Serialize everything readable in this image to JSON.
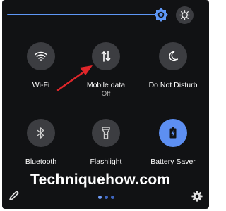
{
  "quick_settings": {
    "brightness": {
      "level": 0.96
    },
    "tiles": [
      {
        "id": "wifi",
        "label": "Wi-Fi",
        "icon": "wifi-icon",
        "active": false
      },
      {
        "id": "mobile-data",
        "label": "Mobile data",
        "status": "Off",
        "icon": "mobile-data-icon",
        "active": false
      },
      {
        "id": "do-not-disturb",
        "label": "Do Not Disturb",
        "icon": "moon-icon",
        "active": false
      },
      {
        "id": "bluetooth",
        "label": "Bluetooth",
        "icon": "bluetooth-icon",
        "active": false
      },
      {
        "id": "flashlight",
        "label": "Flashlight",
        "icon": "flashlight-icon",
        "active": false
      },
      {
        "id": "battery-saver",
        "label": "Battery Saver",
        "icon": "battery-icon",
        "active": true
      }
    ],
    "pages": {
      "current": 1,
      "total": 3
    }
  },
  "watermark": "Techniquehow.com",
  "colors": {
    "panel": "#111214",
    "tile_inactive": "#3c3d41",
    "tile_active": "#5d8ff2",
    "accent": "#5e97f6",
    "annotation_arrow": "#e0262a"
  }
}
